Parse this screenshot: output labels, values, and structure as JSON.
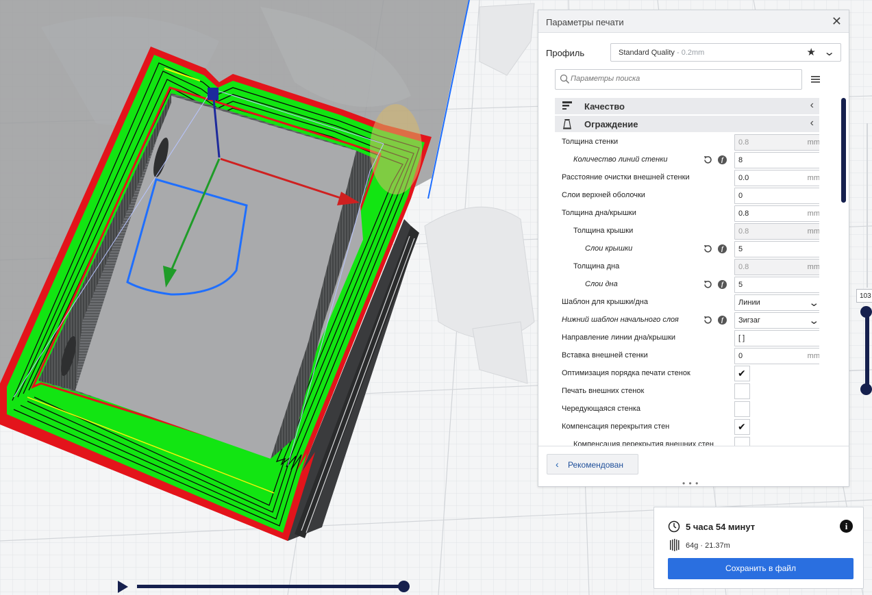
{
  "panel": {
    "title": "Параметры печати",
    "close_icon": "close-icon",
    "profile_label": "Профиль",
    "profile_name": "Standard Quality",
    "profile_sub": " - 0.2mm",
    "search_placeholder": "Параметры поиска",
    "categories": [
      {
        "label": "Качество",
        "icon": "quality-icon"
      },
      {
        "label": "Ограждение",
        "icon": "walls-icon"
      }
    ],
    "settings": [
      {
        "label": "Толщина стенки",
        "value": "0.8",
        "unit": "mm",
        "kind": "field",
        "disabled": true,
        "indent": 0
      },
      {
        "label": "Количество линий стенки",
        "value": "8",
        "unit": "",
        "kind": "field",
        "italic": true,
        "reset": true,
        "indent": 1
      },
      {
        "label": "Расстояние очистки внешней стенки",
        "value": "0.0",
        "unit": "mm",
        "kind": "field",
        "indent": 0
      },
      {
        "label": "Слои верхней оболочки",
        "value": "0",
        "unit": "",
        "kind": "field",
        "indent": 0
      },
      {
        "label": "Толщина дна/крышки",
        "value": "0.8",
        "unit": "mm",
        "kind": "field",
        "indent": 0
      },
      {
        "label": "Толщина крышки",
        "value": "0.8",
        "unit": "mm",
        "kind": "field",
        "disabled": true,
        "indent": 1
      },
      {
        "label": "Слои крышки",
        "value": "5",
        "unit": "",
        "kind": "field",
        "italic": true,
        "reset": true,
        "indent": 2
      },
      {
        "label": "Толщина дна",
        "value": "0.8",
        "unit": "mm",
        "kind": "field",
        "disabled": true,
        "indent": 1
      },
      {
        "label": "Слои дна",
        "value": "5",
        "unit": "",
        "kind": "field",
        "italic": true,
        "reset": true,
        "indent": 2
      },
      {
        "label": "Шаблон для крышки/дна",
        "value": "Линии",
        "unit": "",
        "kind": "dropdown",
        "indent": 0
      },
      {
        "label": "Нижний шаблон начального слоя",
        "value": "Зигзаг",
        "unit": "",
        "kind": "dropdown",
        "italic": true,
        "reset": true,
        "indent": 0
      },
      {
        "label": "Направление линии дна/крышки",
        "value": "[ ]",
        "unit": "",
        "kind": "field",
        "indent": 0
      },
      {
        "label": "Вставка внешней стенки",
        "value": "0",
        "unit": "mm",
        "kind": "field",
        "indent": 0
      },
      {
        "label": "Оптимизация порядка печати стенок",
        "checked": true,
        "kind": "checkbox",
        "indent": 0
      },
      {
        "label": "Печать внешних стенок",
        "checked": false,
        "kind": "checkbox",
        "indent": 0
      },
      {
        "label": "Чередующаяся стенка",
        "checked": false,
        "kind": "checkbox",
        "indent": 0
      },
      {
        "label": "Компенсация перекрытия стен",
        "checked": true,
        "kind": "checkbox",
        "indent": 0
      },
      {
        "label": "Компенсация перекрытия внешних стен",
        "checked": false,
        "kind": "checkbox",
        "indent": 1
      }
    ],
    "recommended_label": "Рекомендован",
    "resize_handle": "• • •"
  },
  "print_info": {
    "time": "5 часа 54 минут",
    "material": "64g · 21.37m",
    "save_label": "Сохранить в файл"
  },
  "layer_slider": {
    "label": "103"
  },
  "colors": {
    "accent": "#2a6fe0",
    "slider": "#16204e",
    "wall_outer": "#e3141b",
    "wall_inner": "#12e512",
    "infill": "#f5f10a",
    "selection": "#1f6fff"
  }
}
